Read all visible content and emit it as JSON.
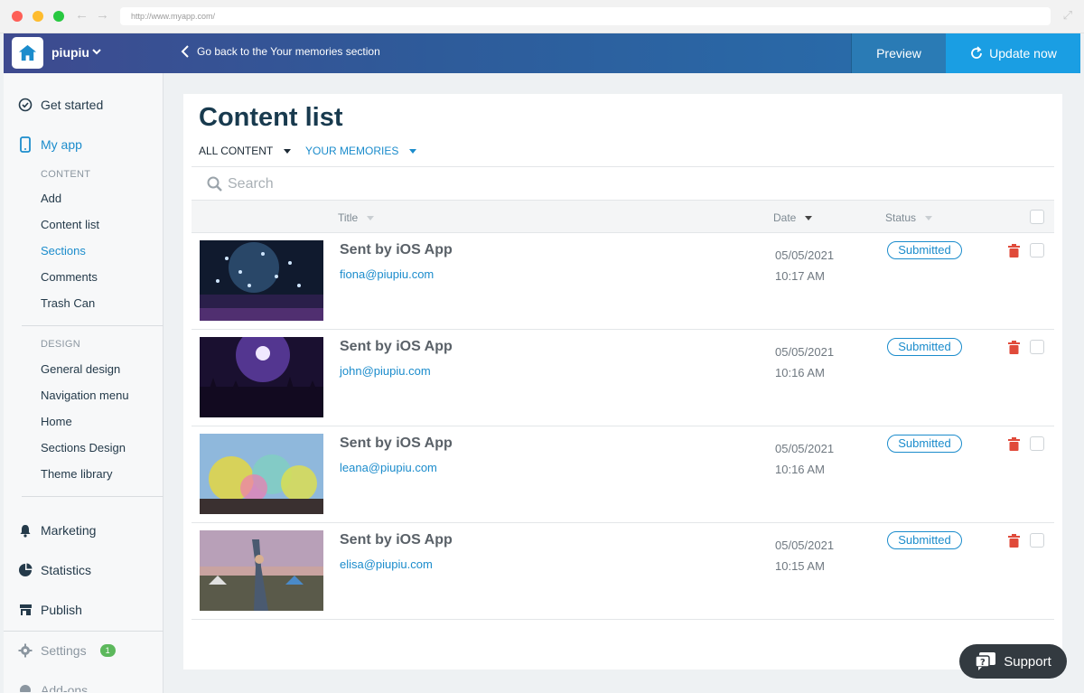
{
  "browser": {
    "url": "http://www.myapp.com/"
  },
  "header": {
    "app_name": "piupiu",
    "back_link": "Go back to the Your memories section",
    "preview_label": "Preview",
    "update_label": "Update now"
  },
  "sidebar": {
    "get_started": "Get started",
    "my_app": "My app",
    "content_heading": "CONTENT",
    "content_items": [
      "Add",
      "Content list",
      "Sections",
      "Comments",
      "Trash Can"
    ],
    "design_heading": "DESIGN",
    "design_items": [
      "General design",
      "Navigation menu",
      "Home",
      "Sections Design",
      "Theme library"
    ],
    "marketing": "Marketing",
    "statistics": "Statistics",
    "publish": "Publish",
    "settings": "Settings",
    "settings_badge": "1",
    "addons": "Add-ons"
  },
  "main": {
    "title": "Content list",
    "filter_all": "ALL CONTENT",
    "filter_memories": "YOUR MEMORIES",
    "search_placeholder": "Search",
    "columns": {
      "title": "Title",
      "date": "Date",
      "status": "Status"
    },
    "rows": [
      {
        "title": "Sent by iOS App",
        "email": "fiona@piupiu.com",
        "date": "05/05/2021",
        "time": "10:17 AM",
        "status": "Submitted"
      },
      {
        "title": "Sent by iOS App",
        "email": "john@piupiu.com",
        "date": "05/05/2021",
        "time": "10:16 AM",
        "status": "Submitted"
      },
      {
        "title": "Sent by iOS App",
        "email": "leana@piupiu.com",
        "date": "05/05/2021",
        "time": "10:16 AM",
        "status": "Submitted"
      },
      {
        "title": "Sent by iOS App",
        "email": "elisa@piupiu.com",
        "date": "05/05/2021",
        "time": "10:15 AM",
        "status": "Submitted"
      }
    ]
  },
  "support_label": "Support",
  "colors": {
    "accent": "#1b8ccc",
    "trash": "#e04a3a",
    "badge": "#5cb85c"
  }
}
